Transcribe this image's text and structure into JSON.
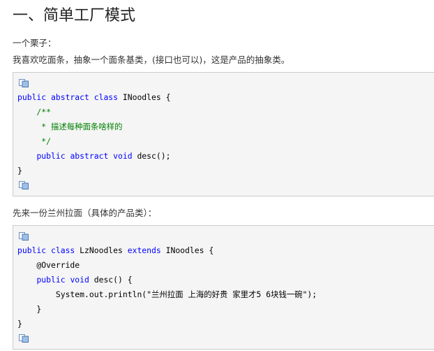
{
  "heading": "一、简单工厂模式",
  "intro": "一个栗子：",
  "desc": "我喜欢吃面条，抽象一个面条基类，(接口也可以)，这是产品的抽象类。",
  "between": "先来一份兰州拉面（具体的产品类）：",
  "code1": {
    "l1": {
      "a": "public abstract class",
      "b": " INoodles {"
    },
    "l2": "    /**",
    "l3": "     * 描述每种面条啥样的",
    "l4": "     */",
    "l5": {
      "i": "    ",
      "a": "public abstract void",
      "b": " desc();"
    },
    "l6": "}"
  },
  "code2": {
    "l1": {
      "a": "public class",
      "b": " LzNoodles ",
      "c": "extends",
      "d": " INoodles {"
    },
    "l2": "    @Override",
    "l3": {
      "i": "    ",
      "a": "public void",
      "b": " desc() {"
    },
    "l4": "        System.out.println(\"兰州拉面 上海的好贵 家里才5 6块钱一碗\");",
    "l5": "    }",
    "l6": "}"
  }
}
